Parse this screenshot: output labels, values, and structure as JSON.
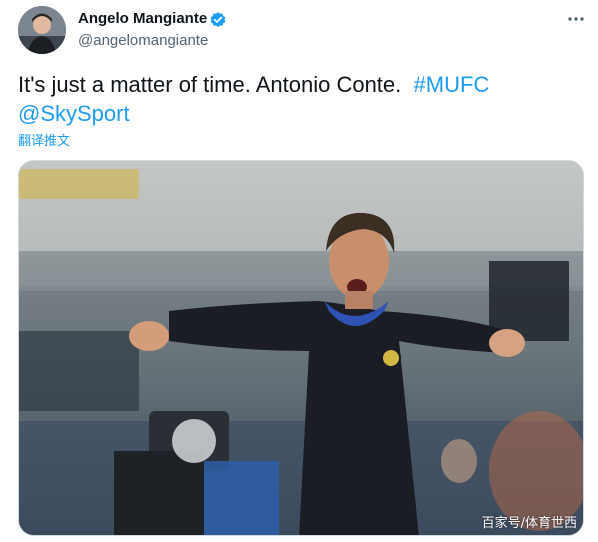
{
  "author": {
    "name": "Angelo Mangiante",
    "handle": "@angelomangiante",
    "verified": true,
    "avatar_icon": "user-avatar"
  },
  "menu_icon": "more-horizontal-icon",
  "tweet": {
    "text_plain": "It's just a matter of time. Antonio Conte.",
    "hashtag": "#MUFC",
    "mention": "@SkySport",
    "translate_label": "翻译推文"
  },
  "media": {
    "description_icon": "photo-coach-shouting"
  },
  "watermark": "百家号/体育世西",
  "colors": {
    "accent": "#1d9bf0",
    "text": "#0f1419",
    "secondary": "#536471",
    "border": "#cfd9de"
  }
}
